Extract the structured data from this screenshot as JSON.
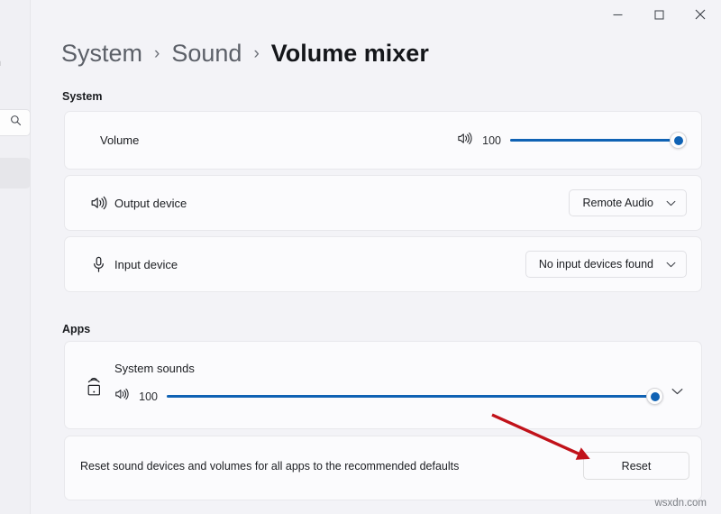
{
  "window": {
    "controls": [
      {
        "name": "minimize",
        "label": "Minimize"
      },
      {
        "name": "maximize",
        "label": "Maximize"
      },
      {
        "name": "close",
        "label": "Close"
      }
    ]
  },
  "sidebar": {
    "title_fragment": "n",
    "search_icon": "search-icon",
    "selected_item": ""
  },
  "breadcrumb": {
    "items": [
      {
        "label": "System",
        "current": false
      },
      {
        "label": "Sound",
        "current": false
      },
      {
        "label": "Volume mixer",
        "current": true
      }
    ],
    "separator": "›"
  },
  "sections": {
    "system": {
      "label": "System",
      "volume": {
        "label": "Volume",
        "icon": "speaker-icon",
        "value": "100",
        "percent": 100
      },
      "output_device": {
        "label": "Output device",
        "icon": "speaker-icon",
        "selected": "Remote Audio",
        "chevron": "chevron-down-icon"
      },
      "input_device": {
        "label": "Input device",
        "icon": "microphone-icon",
        "selected": "No input devices found",
        "chevron": "chevron-down-icon"
      }
    },
    "apps": {
      "label": "Apps",
      "system_sounds": {
        "label": "System sounds",
        "icon": "system-sounds-icon",
        "volume_icon": "speaker-icon",
        "value": "100",
        "percent": 100,
        "expand_chevron": "chevron-down-icon"
      },
      "reset": {
        "description": "Reset sound devices and volumes for all apps to the recommended defaults",
        "button_label": "Reset"
      }
    }
  },
  "annotation": {
    "type": "arrow",
    "color": "#c1121a",
    "points_to": "Reset"
  },
  "watermark": "wsxdn.com",
  "colors": {
    "accent": "#0f62b4",
    "page_background": "#f3f3f7",
    "card_background": "#fbfbfd",
    "card_border": "#e8e8ec",
    "text_primary": "#1b1d21",
    "text_secondary": "#5c6068",
    "annotation_red": "#c1121a"
  }
}
